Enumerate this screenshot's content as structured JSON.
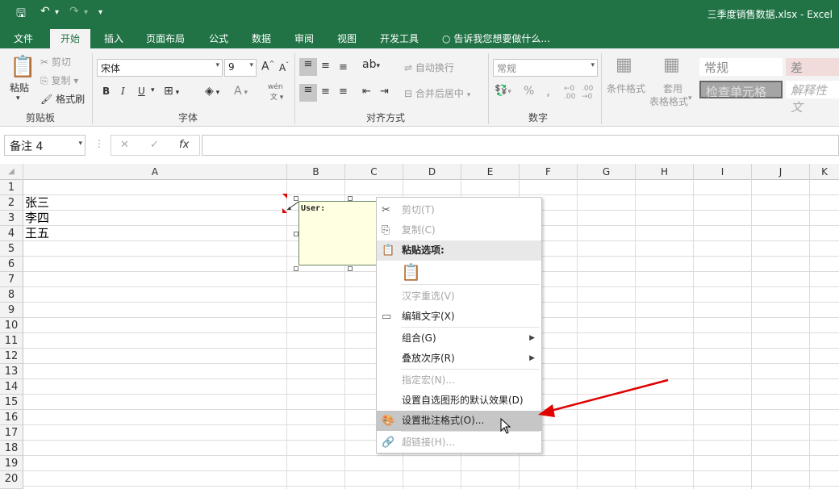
{
  "window": {
    "title": "三季度销售数据.xlsx - Excel"
  },
  "qat": {
    "save": "🖫",
    "undo": "↶",
    "undo_dd": "▾",
    "redo": "↷",
    "redo_dd": "▾",
    "customize": "▾"
  },
  "tabs": [
    "文件",
    "开始",
    "插入",
    "页面布局",
    "公式",
    "数据",
    "审阅",
    "视图",
    "开发工具"
  ],
  "tell_me": "告诉我您想要做什么...",
  "ribbon": {
    "clipboard": {
      "paste": "粘贴",
      "cut": "剪切",
      "copy": "复制",
      "format_painter": "格式刷",
      "group": "剪贴板"
    },
    "font": {
      "name": "宋体",
      "size": "9",
      "bold": "B",
      "italic": "I",
      "underline": "U",
      "grow": "A",
      "shrink": "A",
      "phonetic": "wén",
      "group": "字体"
    },
    "alignment": {
      "wrap": "自动换行",
      "merge": "合并后居中",
      "group": "对齐方式"
    },
    "number": {
      "format": "常规",
      "percent": "%",
      "comma": ",",
      "group": "数字"
    },
    "styles": {
      "conditional": "条件格式",
      "table_format_1": "套用",
      "table_format_2": "表格格式",
      "normal": "常规",
      "bad": "差",
      "check_cell": "检查单元格",
      "explanatory": "解释性文"
    }
  },
  "formula_bar": {
    "name_box": "备注 4",
    "cancel": "✕",
    "enter": "✓",
    "fx": "fx",
    "value": ""
  },
  "columns": [
    "A",
    "B",
    "C",
    "D",
    "E",
    "F",
    "G",
    "H",
    "I",
    "J",
    "K"
  ],
  "rows": [
    "1",
    "2",
    "3",
    "4",
    "5",
    "6",
    "7",
    "8",
    "9",
    "10",
    "11",
    "12",
    "13",
    "14",
    "15",
    "16",
    "17",
    "18",
    "19",
    "20"
  ],
  "cells": {
    "A2": "张三",
    "A3": "李四",
    "A4": "王五"
  },
  "comment": {
    "author": "User:"
  },
  "context_menu": {
    "items": [
      {
        "label": "剪切(T)",
        "icon": "✂"
      },
      {
        "label": "复制(C)",
        "icon": "⎘"
      },
      {
        "label": "粘贴选项:",
        "icon": "📋"
      },
      {
        "label": "汉字重选(V)"
      },
      {
        "label": "编辑文字(X)",
        "icon": "▭"
      },
      {
        "label": "组合(G)",
        "arrow": "▶"
      },
      {
        "label": "叠放次序(R)",
        "arrow": "▶"
      },
      {
        "label": "指定宏(N)..."
      },
      {
        "label": "设置自选图形的默认效果(D)"
      },
      {
        "label": "设置批注格式(O)...",
        "icon": "🎨"
      },
      {
        "label": "超链接(H)...",
        "icon": "🔗"
      }
    ]
  }
}
